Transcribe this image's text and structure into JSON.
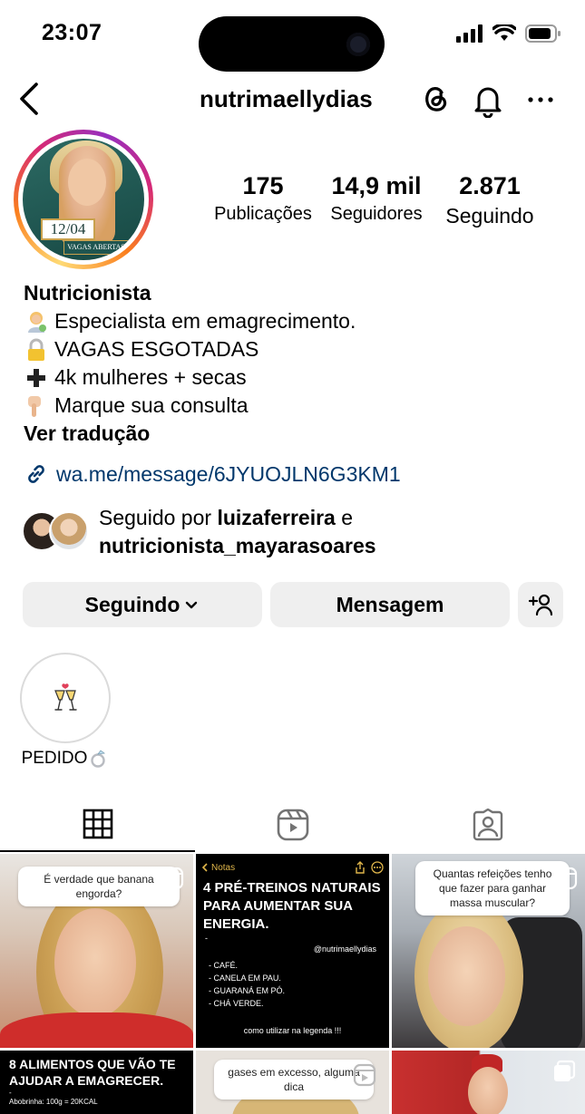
{
  "status_bar": {
    "time": "23:07"
  },
  "header": {
    "username": "nutrimaellydias"
  },
  "profile": {
    "avatar_tag_date": "12/04",
    "avatar_tag_text": "VAGAS ABERTAS",
    "stats": {
      "posts_count": "175",
      "posts_label": "Publicações",
      "followers_count": "14,9 mil",
      "followers_label": "Seguidores",
      "following_count": "2.871",
      "following_label": "Seguindo"
    },
    "bio": {
      "name": "Nutricionista",
      "lines": [
        "Especialista em emagrecimento.",
        "VAGAS ESGOTADAS",
        "4k mulheres + secas",
        " Marque sua consulta"
      ],
      "see_translation": "Ver tradução"
    },
    "link": "wa.me/message/6JYUOJLN6G3KM1",
    "followed_by": {
      "prefix": "Seguido por",
      "user1": "luizaferreira",
      "conjunction": "e",
      "user2": "nutricionista_mayarasoares"
    }
  },
  "actions": {
    "following_label": "Seguindo",
    "message_label": "Mensagem"
  },
  "highlights": [
    {
      "label": "PEDIDO"
    }
  ],
  "posts": {
    "p1_question": "É verdade que banana engorda?",
    "p2_header": "Notas",
    "p2_title": "4 PRÉ-TREINOS NATURAIS PARA AUMENTAR SUA ENERGIA.",
    "p2_dash": "-",
    "p2_handle": "@nutrimaellydias",
    "p2_items": [
      "-   CAFÉ.",
      "-   CANELA EM PAU.",
      "-   GUARANÁ EM PÓ.",
      "-   CHÁ VERDE."
    ],
    "p2_footer": "como utilizar na legenda !!!",
    "p3_question": "Quantas refeições tenho que fazer para ganhar massa muscular?",
    "p4_title": "8 ALIMENTOS QUE VÃO TE AJUDAR A EMAGRECER.",
    "p4_dash": "-",
    "p4_sub": "Abobrinha: 100g = 20KCAL",
    "p5_question": "gases em excesso, alguma dica"
  },
  "colors": {
    "link": "#00376b",
    "button_bg": "#efefef",
    "notes_accent": "#e0b64b"
  }
}
